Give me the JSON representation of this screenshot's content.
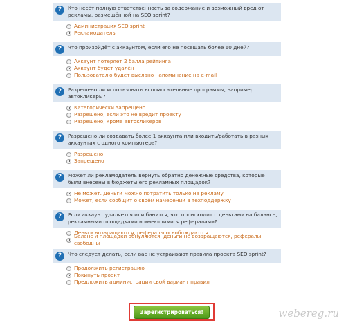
{
  "questions": [
    {
      "text": "Кто несёт полную ответственность за содержание и возможный вред от рекламы, размещённой на SEO sprint?",
      "options": [
        {
          "label": "Администрация SEO sprint",
          "checked": false
        },
        {
          "label": "Рекламодатель",
          "checked": true
        }
      ]
    },
    {
      "text": "Что произойдёт с аккаунтом, если его не посещать более 60 дней?",
      "options": [
        {
          "label": "Аккаунт потеряет 2 балла рейтинга",
          "checked": false
        },
        {
          "label": "Аккаунт будет удалён",
          "checked": true
        },
        {
          "label": "Пользователю будет выслано напоминание на e-mail",
          "checked": false
        }
      ]
    },
    {
      "text": "Разрешено ли использовать вспомогательные программы, например автокликеры?",
      "options": [
        {
          "label": "Категорически запрещено",
          "checked": true
        },
        {
          "label": "Разрешено, если это не вредит проекту",
          "checked": false
        },
        {
          "label": "Разрешено, кроме автокликеров",
          "checked": false
        }
      ]
    },
    {
      "text": "Разрешено ли создавать более 1 аккаунта или входить/работать в разных аккаунтах с одного компьютера?",
      "options": [
        {
          "label": "Разрешено",
          "checked": false
        },
        {
          "label": "Запрещено",
          "checked": true
        }
      ]
    },
    {
      "text": "Может ли рекламодатель вернуть обратно денежные средства, которые были внесены в бюджеты его рекламных площадок?",
      "options": [
        {
          "label": "Не может. Деньги можно потратить только на рекламу",
          "checked": true
        },
        {
          "label": "Может, если сообщит о своём намерении в техподдержку",
          "checked": false
        }
      ]
    },
    {
      "text": "Если аккаунт удаляется или банится, что происходит с деньгами на балансе, рекламными площадками и имеющимися рефералами?",
      "options": [
        {
          "label": "Деньги возвращаются, рефералы освобождаются",
          "checked": false
        },
        {
          "label": "Баланс и площадки обнуляются, деньги не возвращаются, рефералы свободны",
          "checked": true
        }
      ]
    },
    {
      "text": "Что следует делать, если вас не устраивают правила проекта SEO sprint?",
      "options": [
        {
          "label": "Продолжить регистрацию",
          "checked": false
        },
        {
          "label": "Покинуть проект",
          "checked": true
        },
        {
          "label": "Предложить администрации свой вариант правил",
          "checked": false
        }
      ]
    }
  ],
  "question_icon": "question-mark-icon",
  "submit_label": "Зарегистрироваться!",
  "watermark": "webereg.ru",
  "colors": {
    "question_bg": "#dce6f1",
    "option_text": "#c96a1a",
    "button_green": "#6ab12c",
    "highlight_red": "#e03b35"
  }
}
